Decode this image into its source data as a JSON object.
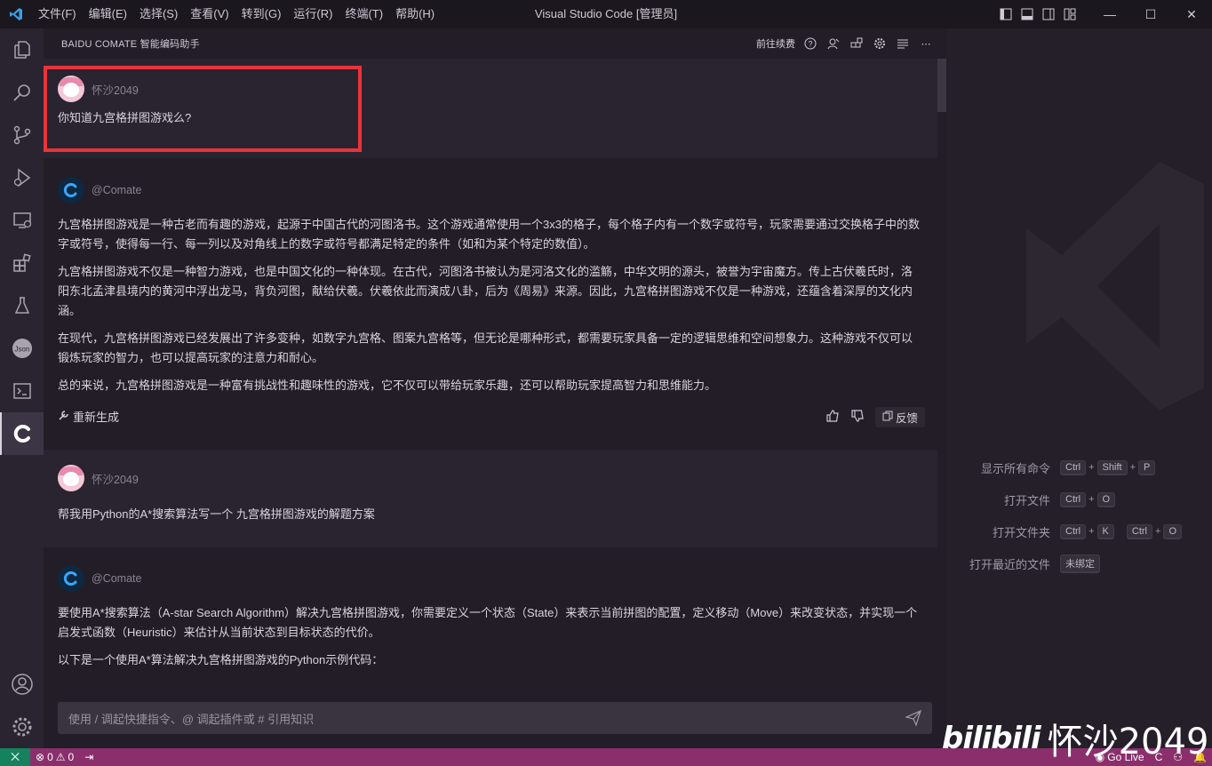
{
  "window": {
    "title": "Visual Studio Code [管理员]",
    "menu": [
      "文件(F)",
      "编辑(E)",
      "选择(S)",
      "查看(V)",
      "转到(G)",
      "运行(R)",
      "终端(T)",
      "帮助(H)"
    ]
  },
  "panel": {
    "title": "BAIDU COMATE 智能编码助手",
    "go_label": "前往续费"
  },
  "messages": {
    "user1": {
      "name": "怀沙2049",
      "text": "你知道九宫格拼图游戏么?"
    },
    "bot1": {
      "name": "@Comate",
      "paragraphs": [
        "九宫格拼图游戏是一种古老而有趣的游戏，起源于中国古代的河图洛书。这个游戏通常使用一个3x3的格子，每个格子内有一个数字或符号，玩家需要通过交换格子中的数字或符号，使得每一行、每一列以及对角线上的数字或符号都满足特定的条件（如和为某个特定的数值）。",
        "九宫格拼图游戏不仅是一种智力游戏，也是中国文化的一种体现。在古代，河图洛书被认为是河洛文化的滥觞，中华文明的源头，被誉为宇宙魔方。传上古伏羲氏时，洛阳东北孟津县境内的黄河中浮出龙马，背负河图，献给伏羲。伏羲依此而演成八卦，后为《周易》来源。因此，九宫格拼图游戏不仅是一种游戏，还蕴含着深厚的文化内涵。",
        "在现代，九宫格拼图游戏已经发展出了许多变种，如数字九宫格、图案九宫格等，但无论是哪种形式，都需要玩家具备一定的逻辑思维和空间想象力。这种游戏不仅可以锻炼玩家的智力，也可以提高玩家的注意力和耐心。",
        "总的来说，九宫格拼图游戏是一种富有挑战性和趣味性的游戏，它不仅可以带给玩家乐趣，还可以帮助玩家提高智力和思维能力。"
      ],
      "regen_label": "重新生成",
      "feedback_label": "反馈"
    },
    "user2": {
      "name": "怀沙2049",
      "text": "帮我用Python的A*搜索算法写一个 九宫格拼图游戏的解题方案"
    },
    "bot2": {
      "name": "@Comate",
      "paragraphs": [
        "要使用A*搜索算法（A-star Search Algorithm）解决九宫格拼图游戏，你需要定义一个状态（State）来表示当前拼图的配置，定义移动（Move）来改变状态，并实现一个启发式函数（Heuristic）来估计从当前状态到目标状态的代价。",
        "以下是一个使用A*算法解决九宫格拼图游戏的Python示例代码："
      ]
    }
  },
  "composer": {
    "placeholder": "使用 / 调起快捷指令、@ 调起插件或 # 引用知识"
  },
  "shortcuts": [
    {
      "label": "显示所有命令",
      "keys": [
        [
          "Ctrl",
          "Shift",
          "P"
        ]
      ]
    },
    {
      "label": "打开文件",
      "keys": [
        [
          "Ctrl",
          "O"
        ]
      ]
    },
    {
      "label": "打开文件夹",
      "keys": [
        [
          "Ctrl",
          "K"
        ],
        [
          "Ctrl",
          "O"
        ]
      ]
    },
    {
      "label": "打开最近的文件",
      "keys": [
        [
          "未绑定"
        ]
      ]
    }
  ],
  "statusbar": {
    "errors": "0",
    "warnings": "0",
    "golive": "Go Live"
  },
  "watermark": {
    "site": "bilibili",
    "user": "怀沙2049"
  },
  "colors": {
    "accent": "#8a2f6c",
    "highlight": "#e8343a",
    "remote": "#16825d"
  }
}
